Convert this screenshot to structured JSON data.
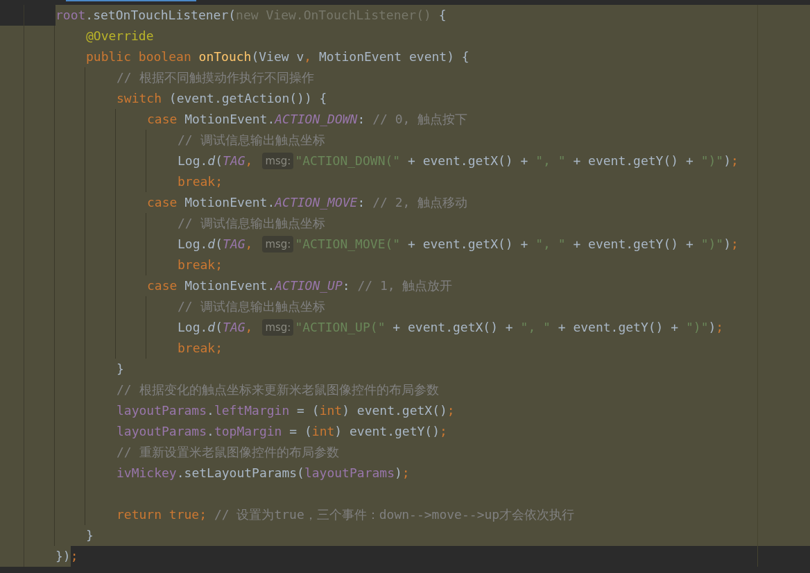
{
  "editor": {
    "lines": [
      {
        "tokens": [
          {
            "kind": "field",
            "text": "root"
          },
          {
            "kind": "plain",
            "text": ".setOnTouchListener("
          },
          {
            "kind": "anon",
            "text": "new View.OnTouchListener()"
          },
          {
            "kind": "plain",
            "text": " {"
          }
        ],
        "children": [
          {
            "tokens": [
              {
                "kind": "annotation",
                "text": "@Override"
              }
            ]
          },
          {
            "tokens": [
              {
                "kind": "keyword",
                "text": "public boolean "
              },
              {
                "kind": "decl",
                "text": "onTouch"
              },
              {
                "kind": "plain",
                "text": "(View v"
              },
              {
                "kind": "keyword",
                "text": ","
              },
              {
                "kind": "plain",
                "text": " MotionEvent event) {"
              }
            ],
            "children": [
              {
                "tokens": [
                  {
                    "kind": "comment",
                    "text": "// 根据不同触摸动作执行不同操作"
                  }
                ]
              },
              {
                "tokens": [
                  {
                    "kind": "keyword",
                    "text": "switch "
                  },
                  {
                    "kind": "plain",
                    "text": "(event.getAction()) {"
                  }
                ],
                "children": [
                  {
                    "tokens": [
                      {
                        "kind": "keyword",
                        "text": "case "
                      },
                      {
                        "kind": "plain",
                        "text": "MotionEvent."
                      },
                      {
                        "kind": "const",
                        "text": "ACTION_DOWN"
                      },
                      {
                        "kind": "plain",
                        "text": ": "
                      },
                      {
                        "kind": "comment",
                        "text": "// 0, 触点按下"
                      }
                    ],
                    "children": [
                      {
                        "tokens": [
                          {
                            "kind": "comment",
                            "text": "// 调试信息输出触点坐标"
                          }
                        ]
                      },
                      {
                        "tokens": [
                          {
                            "kind": "plain",
                            "text": "Log."
                          },
                          {
                            "kind": "static",
                            "text": "d"
                          },
                          {
                            "kind": "plain",
                            "text": "("
                          },
                          {
                            "kind": "const",
                            "text": "TAG"
                          },
                          {
                            "kind": "keyword",
                            "text": ","
                          },
                          {
                            "kind": "hint",
                            "text": "msg:"
                          },
                          {
                            "kind": "string",
                            "text": "\"ACTION_DOWN(\""
                          },
                          {
                            "kind": "plain",
                            "text": " + event.getX() + "
                          },
                          {
                            "kind": "string",
                            "text": "\", \""
                          },
                          {
                            "kind": "plain",
                            "text": " + event.getY() + "
                          },
                          {
                            "kind": "string",
                            "text": "\")\""
                          },
                          {
                            "kind": "plain",
                            "text": ")"
                          },
                          {
                            "kind": "keyword",
                            "text": ";"
                          }
                        ]
                      },
                      {
                        "tokens": [
                          {
                            "kind": "keyword",
                            "text": "break;"
                          }
                        ]
                      }
                    ]
                  },
                  {
                    "tokens": [
                      {
                        "kind": "keyword",
                        "text": "case "
                      },
                      {
                        "kind": "plain",
                        "text": "MotionEvent."
                      },
                      {
                        "kind": "const",
                        "text": "ACTION_MOVE"
                      },
                      {
                        "kind": "plain",
                        "text": ": "
                      },
                      {
                        "kind": "comment",
                        "text": "// 2, 触点移动"
                      }
                    ],
                    "children": [
                      {
                        "tokens": [
                          {
                            "kind": "comment",
                            "text": "// 调试信息输出触点坐标"
                          }
                        ]
                      },
                      {
                        "tokens": [
                          {
                            "kind": "plain",
                            "text": "Log."
                          },
                          {
                            "kind": "static",
                            "text": "d"
                          },
                          {
                            "kind": "plain",
                            "text": "("
                          },
                          {
                            "kind": "const",
                            "text": "TAG"
                          },
                          {
                            "kind": "keyword",
                            "text": ","
                          },
                          {
                            "kind": "hint",
                            "text": "msg:"
                          },
                          {
                            "kind": "string",
                            "text": "\"ACTION_MOVE(\""
                          },
                          {
                            "kind": "plain",
                            "text": " + event.getX() + "
                          },
                          {
                            "kind": "string",
                            "text": "\", \""
                          },
                          {
                            "kind": "plain",
                            "text": " + event.getY() + "
                          },
                          {
                            "kind": "string",
                            "text": "\")\""
                          },
                          {
                            "kind": "plain",
                            "text": ")"
                          },
                          {
                            "kind": "keyword",
                            "text": ";"
                          }
                        ]
                      },
                      {
                        "tokens": [
                          {
                            "kind": "keyword",
                            "text": "break;"
                          }
                        ]
                      }
                    ]
                  },
                  {
                    "tokens": [
                      {
                        "kind": "keyword",
                        "text": "case "
                      },
                      {
                        "kind": "plain",
                        "text": "MotionEvent."
                      },
                      {
                        "kind": "const",
                        "text": "ACTION_UP"
                      },
                      {
                        "kind": "plain",
                        "text": ": "
                      },
                      {
                        "kind": "comment",
                        "text": "// 1, 触点放开"
                      }
                    ],
                    "children": [
                      {
                        "tokens": [
                          {
                            "kind": "comment",
                            "text": "// 调试信息输出触点坐标"
                          }
                        ]
                      },
                      {
                        "tokens": [
                          {
                            "kind": "plain",
                            "text": "Log."
                          },
                          {
                            "kind": "static",
                            "text": "d"
                          },
                          {
                            "kind": "plain",
                            "text": "("
                          },
                          {
                            "kind": "const",
                            "text": "TAG"
                          },
                          {
                            "kind": "keyword",
                            "text": ","
                          },
                          {
                            "kind": "hint",
                            "text": "msg:"
                          },
                          {
                            "kind": "string",
                            "text": "\"ACTION_UP(\""
                          },
                          {
                            "kind": "plain",
                            "text": " + event.getX() + "
                          },
                          {
                            "kind": "string",
                            "text": "\", \""
                          },
                          {
                            "kind": "plain",
                            "text": " + event.getY() + "
                          },
                          {
                            "kind": "string",
                            "text": "\")\""
                          },
                          {
                            "kind": "plain",
                            "text": ")"
                          },
                          {
                            "kind": "keyword",
                            "text": ";"
                          }
                        ]
                      },
                      {
                        "tokens": [
                          {
                            "kind": "keyword",
                            "text": "break;"
                          }
                        ]
                      }
                    ]
                  }
                ]
              },
              {
                "tokens": [
                  {
                    "kind": "plain",
                    "text": "}"
                  }
                ]
              },
              {
                "tokens": [
                  {
                    "kind": "comment",
                    "text": "// 根据变化的触点坐标来更新米老鼠图像控件的布局参数"
                  }
                ]
              },
              {
                "tokens": [
                  {
                    "kind": "field",
                    "text": "layoutParams"
                  },
                  {
                    "kind": "plain",
                    "text": "."
                  },
                  {
                    "kind": "field",
                    "text": "leftMargin"
                  },
                  {
                    "kind": "plain",
                    "text": " = ("
                  },
                  {
                    "kind": "keyword",
                    "text": "int"
                  },
                  {
                    "kind": "plain",
                    "text": ") event.getX()"
                  },
                  {
                    "kind": "keyword",
                    "text": ";"
                  }
                ]
              },
              {
                "tokens": [
                  {
                    "kind": "field",
                    "text": "layoutParams"
                  },
                  {
                    "kind": "plain",
                    "text": "."
                  },
                  {
                    "kind": "field",
                    "text": "topMargin"
                  },
                  {
                    "kind": "plain",
                    "text": " = ("
                  },
                  {
                    "kind": "keyword",
                    "text": "int"
                  },
                  {
                    "kind": "plain",
                    "text": ") event.getY()"
                  },
                  {
                    "kind": "keyword",
                    "text": ";"
                  }
                ]
              },
              {
                "tokens": [
                  {
                    "kind": "comment",
                    "text": "// 重新设置米老鼠图像控件的布局参数"
                  }
                ]
              },
              {
                "tokens": [
                  {
                    "kind": "field",
                    "text": "ivMickey"
                  },
                  {
                    "kind": "plain",
                    "text": ".setLayoutParams("
                  },
                  {
                    "kind": "field",
                    "text": "layoutParams"
                  },
                  {
                    "kind": "plain",
                    "text": ")"
                  },
                  {
                    "kind": "keyword",
                    "text": ";"
                  }
                ]
              },
              {
                "blank_before": true,
                "tokens": [
                  {
                    "kind": "keyword",
                    "text": "return true; "
                  },
                  {
                    "kind": "comment",
                    "text": "// 设置为true，三个事件：down-->move-->up才会依次执行"
                  }
                ]
              }
            ]
          },
          {
            "tokens": [
              {
                "kind": "plain",
                "text": "}"
              }
            ]
          }
        ]
      },
      {
        "tokens": [
          {
            "kind": "plain",
            "text": "})"
          },
          {
            "kind": "keyword",
            "text": ";"
          }
        ]
      }
    ]
  }
}
